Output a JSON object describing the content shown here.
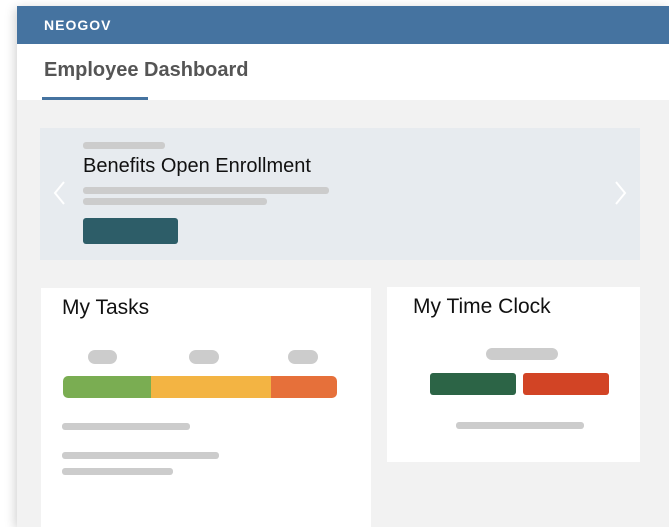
{
  "app": {
    "brand": "NEOGOV"
  },
  "header": {
    "title": "Employee Dashboard"
  },
  "banner": {
    "title": "Benefits Open Enrollment"
  },
  "tasks": {
    "title": "My Tasks",
    "progress_segments": [
      {
        "name": "green",
        "fraction": 0.32,
        "color": "#7aad52"
      },
      {
        "name": "yellow",
        "fraction": 0.44,
        "color": "#f3b443"
      },
      {
        "name": "orange",
        "fraction": 0.24,
        "color": "#e6703a"
      }
    ]
  },
  "time_clock": {
    "title": "My Time Clock",
    "buttons": [
      {
        "name": "clock-in",
        "color": "#2c6446"
      },
      {
        "name": "clock-out",
        "color": "#d24425"
      }
    ]
  },
  "colors": {
    "accent": "#4573a0",
    "banner_button": "#2d5d68",
    "placeholder": "#cccccc"
  },
  "icons": [
    "chevron-left-icon",
    "chevron-right-icon"
  ]
}
